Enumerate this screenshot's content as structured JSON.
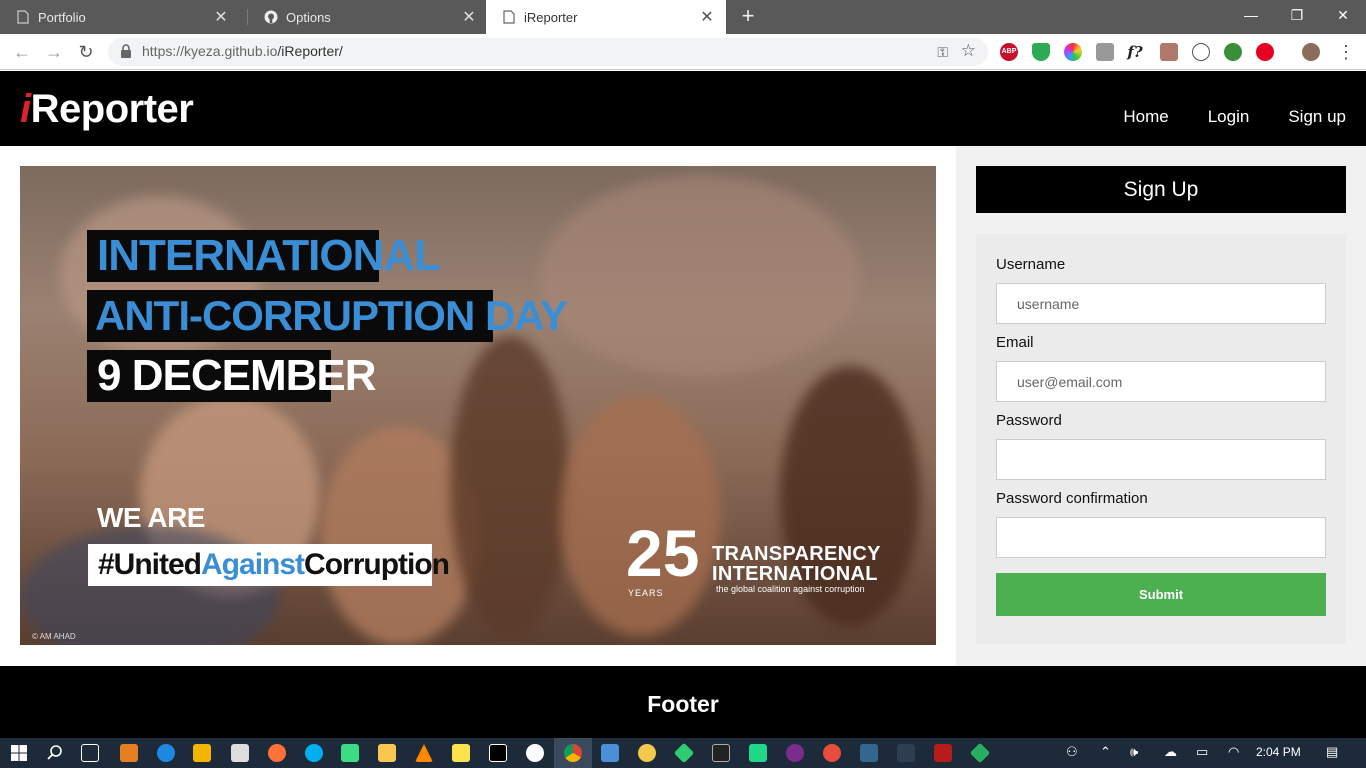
{
  "browser": {
    "tabs": [
      {
        "label": "Portfolio",
        "icon": "page-icon"
      },
      {
        "label": "Options",
        "icon": "github-icon"
      },
      {
        "label": "iReporter",
        "icon": "page-icon",
        "active": true
      }
    ],
    "url_host": "https://kyeza.github.io",
    "url_path": "/iReporter/",
    "extensions": [
      "ABP",
      "f?"
    ]
  },
  "site": {
    "logo_i": "i",
    "logo_rest": "Reporter",
    "nav": [
      "Home",
      "Login",
      "Sign up"
    ],
    "hero": {
      "line1": "INTERNATIONAL",
      "line2": "ANTI-CORRUPTION DAY",
      "line3": "9 DECEMBER",
      "we_are": "WE ARE",
      "hashtag_a": "#United",
      "hashtag_b": "Against",
      "hashtag_c": "Corruption",
      "ti_number": "25",
      "ti_years": "YEARS",
      "ti_name1": "TRANSPARENCY",
      "ti_name2": "INTERNATIONAL",
      "ti_tagline": "the global coalition against corruption",
      "credit": "© AM AHAD"
    },
    "signup": {
      "title": "Sign Up",
      "username_label": "Username",
      "username_placeholder": "username",
      "email_label": "Email",
      "email_placeholder": "user@email.com",
      "password_label": "Password",
      "confirm_label": "Password confirmation",
      "submit_label": "Submit"
    },
    "footer": "Footer"
  },
  "taskbar": {
    "time": "2:04 PM"
  }
}
